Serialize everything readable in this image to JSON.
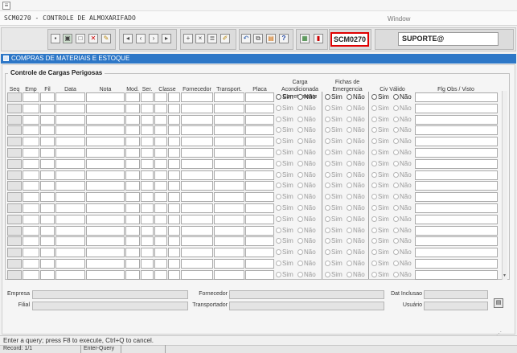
{
  "window": {
    "title": "SCM0270 - CONTROLE DE ALMOXARIFADO",
    "window_label": "Window"
  },
  "toolbar": {
    "form_code": "SCM0270",
    "user": "SUPORTE@",
    "icons": [
      "save-icon",
      "print-icon",
      "preview-icon",
      "exit-icon",
      "edit-icon",
      "first-record-icon",
      "previous-record-icon",
      "next-record-icon",
      "last-record-icon",
      "insert-record-icon",
      "delete-record-icon",
      "list-values-icon",
      "clear-icon",
      "undo-icon",
      "copy-icon",
      "paste-icon",
      "help-icon",
      "report-icon",
      "exit-door-icon"
    ]
  },
  "canvas": {
    "title": "COMPRAS DE MATERIAIS E ESTOQUE",
    "accent_color": "#2d77c7"
  },
  "block": {
    "title": "Controle de Cargas Perigosas",
    "columns": {
      "seq": "Seq",
      "emp": "Emp",
      "fil": "Fil",
      "data": "Data",
      "nota": "Nota",
      "mod": "Mod.",
      "ser": "Ser.",
      "classe": "Classe",
      "fornecedor": "Fornecedor",
      "transport": "Transport.",
      "placa": "Placa",
      "carga": "Carga Acondicionada Corretamente",
      "fichas": "Fichas de Emergencia",
      "civ": "Civ Válido",
      "flg": "Flg Obs / Visto"
    },
    "radio_sim": "Sim",
    "radio_nao": "Não",
    "row_count": 17
  },
  "footer": {
    "empresa_label": "Empresa",
    "filial_label": "Filial",
    "fornecedor_label": "Fornecedor",
    "transportador_label": "Transportador",
    "dat_inclusao_label": "Dat Inclusao",
    "usuario_label": "Usuário"
  },
  "status": {
    "message": "Enter a query;  press F8 to execute, Ctrl+Q to cancel.",
    "record": "Record: 1/1",
    "mode": "Enter-Query"
  }
}
